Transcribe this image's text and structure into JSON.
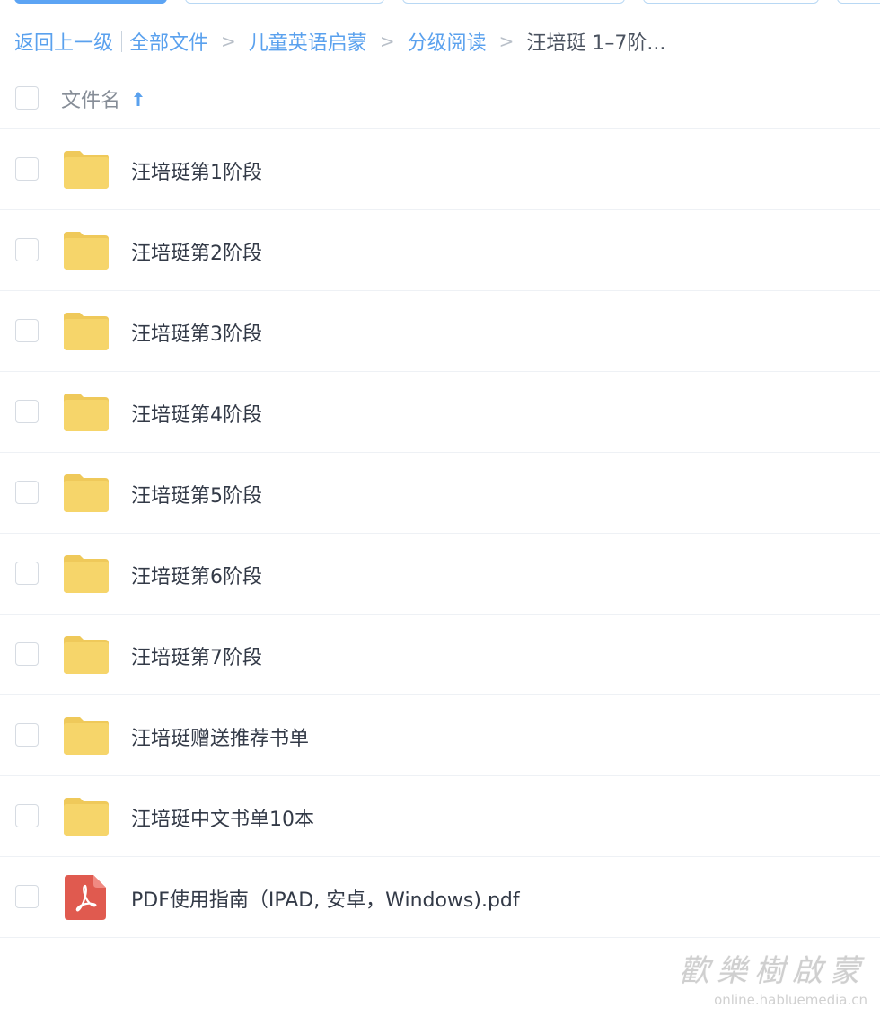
{
  "breadcrumb": {
    "back": "返回上一级",
    "items": [
      "全部文件",
      "儿童英语启蒙",
      "分级阅读"
    ],
    "current": "汪培珽 1–7阶...",
    "separator": ">"
  },
  "list_header": {
    "column_name": "文件名",
    "sort": "ascending"
  },
  "files": [
    {
      "name": "汪培珽第1阶段",
      "type": "folder"
    },
    {
      "name": "汪培珽第2阶段",
      "type": "folder"
    },
    {
      "name": "汪培珽第3阶段",
      "type": "folder"
    },
    {
      "name": "汪培珽第4阶段",
      "type": "folder"
    },
    {
      "name": "汪培珽第5阶段",
      "type": "folder"
    },
    {
      "name": "汪培珽第6阶段",
      "type": "folder"
    },
    {
      "name": "汪培珽第7阶段",
      "type": "folder"
    },
    {
      "name": "汪培珽赠送推荐书单",
      "type": "folder"
    },
    {
      "name": "汪培珽中文书单10本",
      "type": "folder"
    },
    {
      "name": "PDF使用指南（IPAD, 安卓，Windows).pdf",
      "type": "pdf"
    }
  ],
  "colors": {
    "accent": "#5aa1ee",
    "folder": "#f6d56a",
    "pdf": "#e05a4f"
  },
  "watermark": {
    "title": "歡樂樹啟蒙",
    "url": "online.habluemedia.cn"
  }
}
